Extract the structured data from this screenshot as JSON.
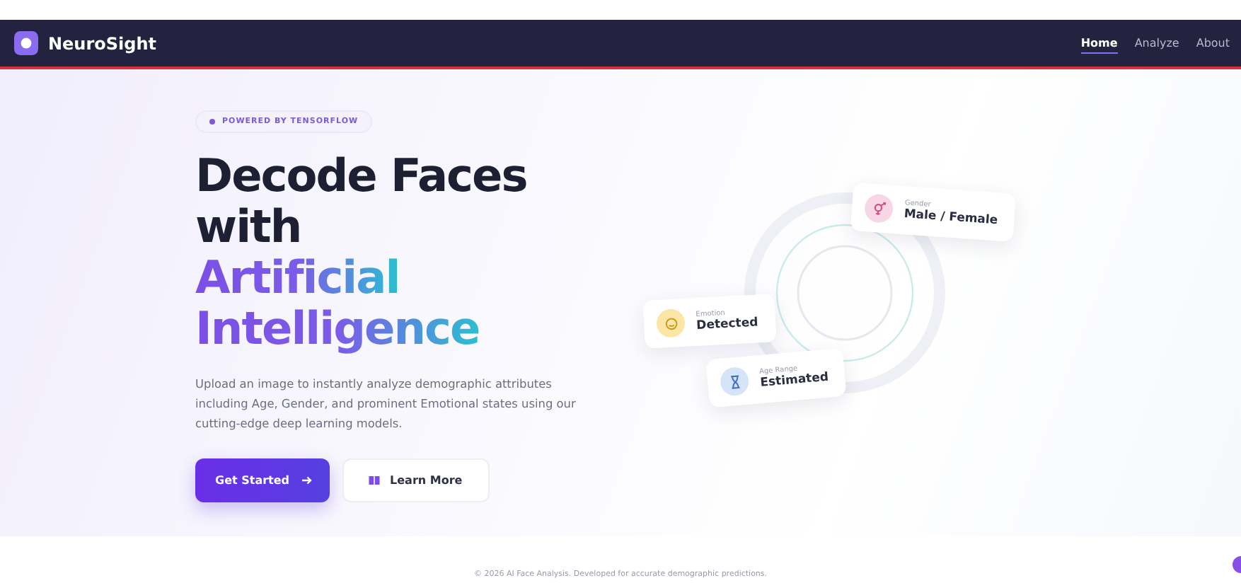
{
  "nav": {
    "brand": "NeuroSight",
    "links": [
      {
        "label": "Home",
        "selected": true
      },
      {
        "label": "Analyze",
        "selected": false
      },
      {
        "label": "About",
        "selected": false
      }
    ]
  },
  "hero": {
    "badge": "POWERED BY TENSORFLOW",
    "title_lines": [
      {
        "text": "Decode Faces",
        "kind": "plain"
      },
      {
        "text": "with",
        "kind": "plain"
      },
      {
        "text": "Artificial",
        "kind": "gradient"
      },
      {
        "text": "Intelligence",
        "kind": "gradient"
      }
    ],
    "description": "Upload an image to instantly analyze demographic attributes including Age, Gender, and prominent Emotional states using our cutting-edge deep learning models.",
    "buttons": [
      {
        "label": "Get Started",
        "kind": "primary"
      },
      {
        "label": "Learn More",
        "kind": "secondary"
      }
    ]
  },
  "cards": [
    {
      "kind": "gender",
      "label": "Gender",
      "value": "Male / Female",
      "color": "#f9d6e6"
    },
    {
      "kind": "emotion",
      "label": "Emotion",
      "value": "Detected",
      "color": "#fbe6a6"
    },
    {
      "kind": "age",
      "label": "Age Range",
      "value": "Estimated",
      "color": "#d5e4f8"
    }
  ],
  "footer": "© 2026 AI Face Analysis. Developed for accurate demographic predictions."
}
